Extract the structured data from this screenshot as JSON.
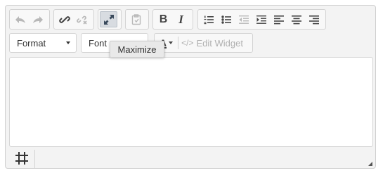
{
  "toolbar": {
    "history": {
      "undo_icon": "undo-icon",
      "redo_icon": "redo-icon"
    },
    "links": {
      "link_icon": "link-icon",
      "unlink_icon": "unlink-icon"
    },
    "view": {
      "maximize_icon": "maximize-icon"
    },
    "clipboard": {
      "paste_icon": "paste-icon"
    },
    "basic_styles": {
      "bold_label": "B",
      "italic_label": "I"
    },
    "paragraph": {
      "numbered_list_icon": "numbered-list-icon",
      "bulleted_list_icon": "bulleted-list-icon",
      "outdent_icon": "outdent-icon",
      "indent_icon": "indent-icon",
      "align_left_icon": "align-left-icon",
      "align_center_icon": "align-center-icon",
      "align_right_icon": "align-right-icon"
    },
    "format_label": "Format",
    "font_label": "Font",
    "text_color_label": "A",
    "edit_widget_code": "</>",
    "edit_widget_label": "Edit Widget"
  },
  "tooltip": {
    "text": "Maximize"
  },
  "bottom": {
    "table_icon": "table-icon"
  },
  "colors": {
    "accent_active": "#d8dce1",
    "border": "#cfcfcf",
    "background": "#f3f3f3"
  }
}
